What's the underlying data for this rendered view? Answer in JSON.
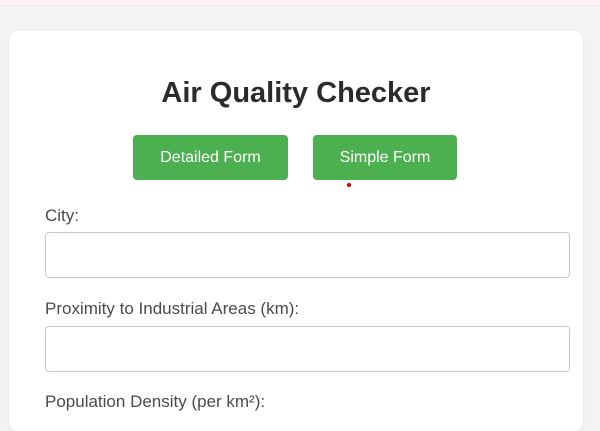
{
  "page": {
    "title": "Air Quality Checker"
  },
  "buttons": {
    "detailed_label": "Detailed Form",
    "simple_label": "Simple Form"
  },
  "form": {
    "city": {
      "label": "City:",
      "value": "",
      "placeholder": ""
    },
    "proximity": {
      "label": "Proximity to Industrial Areas (km):",
      "value": "",
      "placeholder": ""
    },
    "population": {
      "label": "Population Density (per km²):"
    }
  },
  "colors": {
    "accent": "#4caf50",
    "background": "#f2f3f5",
    "card": "#ffffff",
    "title": "#2b2b2b",
    "label": "#4a4a4a",
    "cursor_marker": "#d40000"
  }
}
